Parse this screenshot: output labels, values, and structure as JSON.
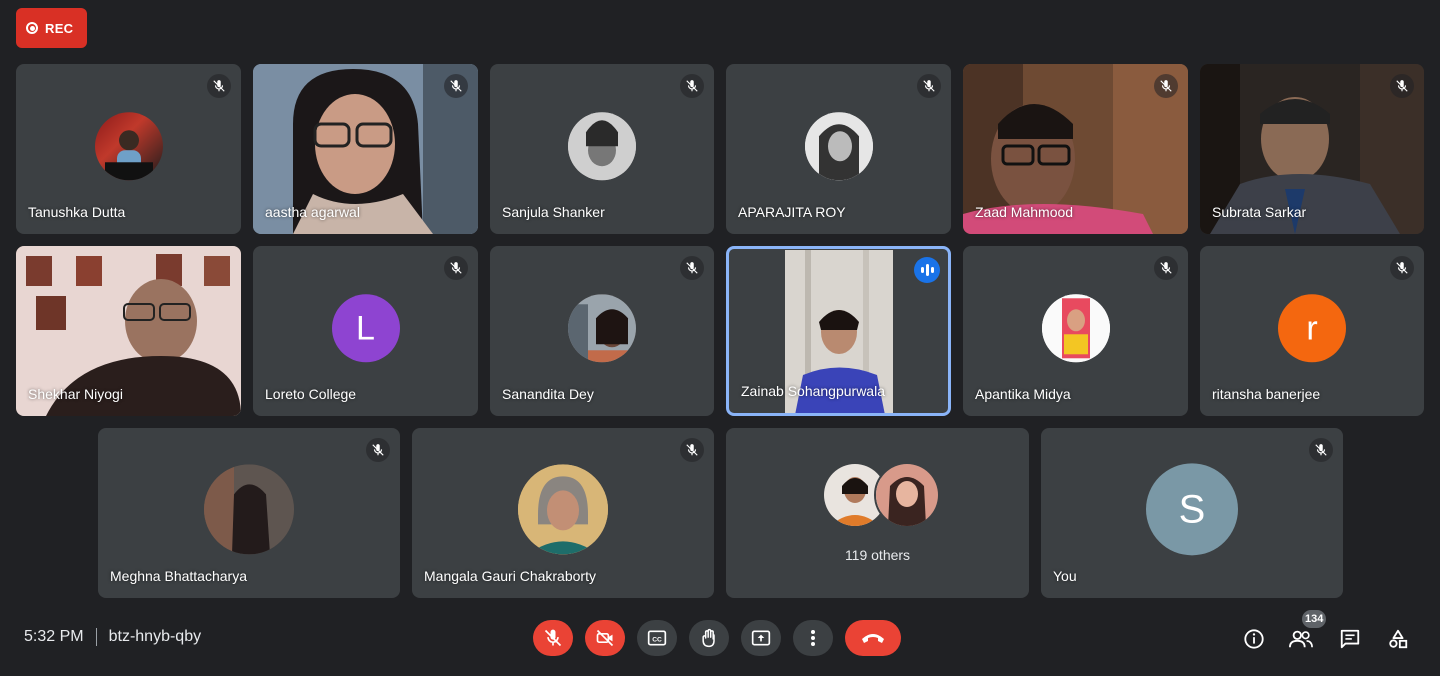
{
  "rec": {
    "label": "REC"
  },
  "meeting": {
    "time": "5:32 PM",
    "code": "btz-hnyb-qby"
  },
  "participants": [
    {
      "name": "Tanushka Dutta"
    },
    {
      "name": "aastha agarwal"
    },
    {
      "name": "Sanjula Shanker"
    },
    {
      "name": "APARAJITA ROY"
    },
    {
      "name": "Zaad Mahmood"
    },
    {
      "name": "Subrata Sarkar"
    },
    {
      "name": "Shekhar Niyogi"
    },
    {
      "name": "Loreto College",
      "initial": "L",
      "color": "#8e44d1"
    },
    {
      "name": "Sanandita Dey"
    },
    {
      "name": "Zainab Sohangpurwala"
    },
    {
      "name": "Apantika Midya"
    },
    {
      "name": "ritansha banerjee",
      "initial": "r",
      "color": "#f4670f"
    },
    {
      "name": "Meghna Bhattacharya"
    },
    {
      "name": "Mangala Gauri Chakraborty"
    },
    {
      "others_label": "119 others"
    },
    {
      "name": "You",
      "initial": "S",
      "color": "#7a98a6"
    }
  ],
  "people_count": "134",
  "colors": {
    "background": "#202124",
    "tile": "#3c4043",
    "red": "#ea4335",
    "active_border": "#8ab4f8"
  }
}
